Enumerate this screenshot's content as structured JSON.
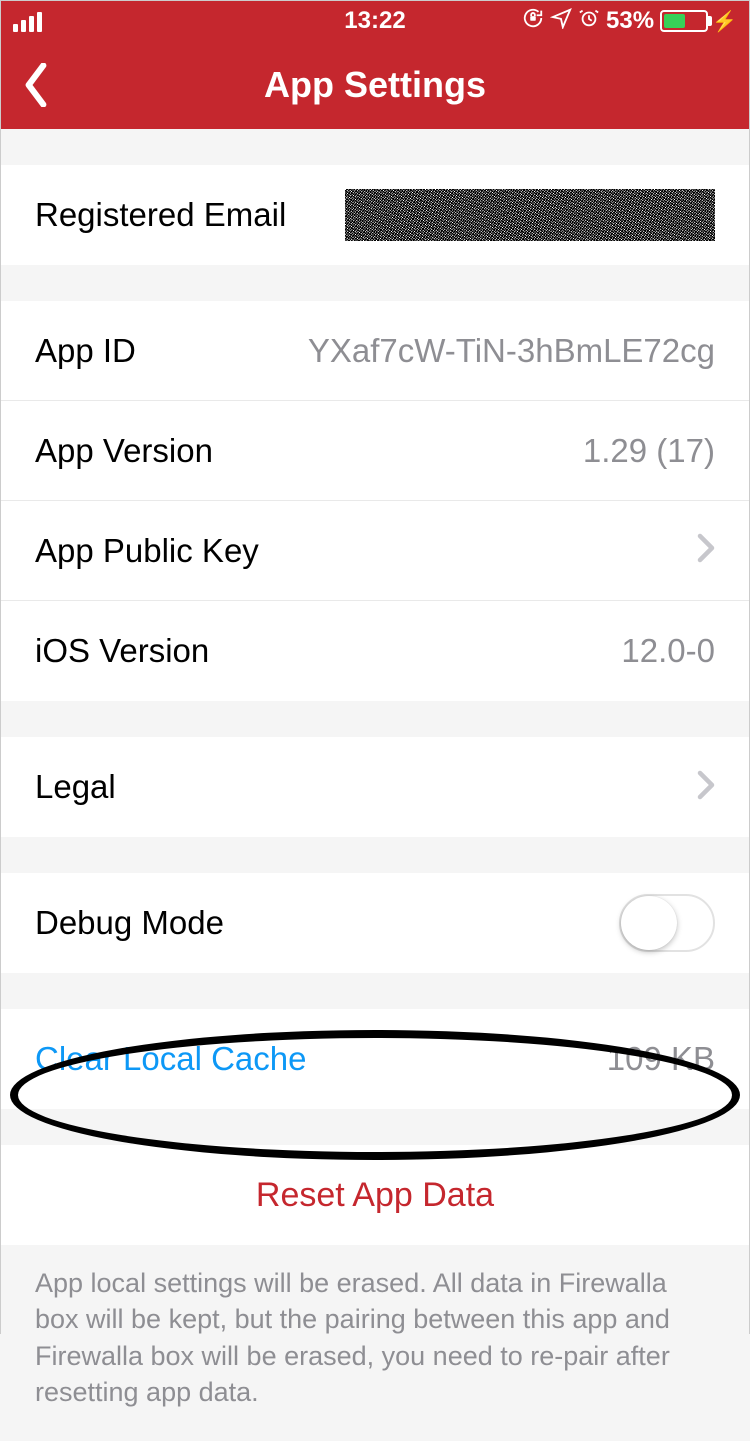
{
  "statusBar": {
    "time": "13:22",
    "batteryPercent": "53%",
    "batteryFill": 53
  },
  "nav": {
    "title": "App Settings"
  },
  "rows": {
    "registeredEmail": {
      "label": "Registered Email"
    },
    "appId": {
      "label": "App ID",
      "value": "YXaf7cW-TiN-3hBmLE72cg"
    },
    "appVersion": {
      "label": "App Version",
      "value": "1.29 (17)"
    },
    "appPublicKey": {
      "label": "App Public Key"
    },
    "iosVersion": {
      "label": "iOS Version",
      "value": "12.0-0"
    },
    "legal": {
      "label": "Legal"
    },
    "debugMode": {
      "label": "Debug Mode",
      "enabled": false
    },
    "clearCache": {
      "label": "Clear Local Cache",
      "value": "109 KB"
    },
    "reset": {
      "label": "Reset App Data"
    }
  },
  "footer": "App local settings will be erased. All data in Firewalla box will be kept, but the pairing between this app and Firewalla box will be erased, you need to re-pair after resetting app data."
}
